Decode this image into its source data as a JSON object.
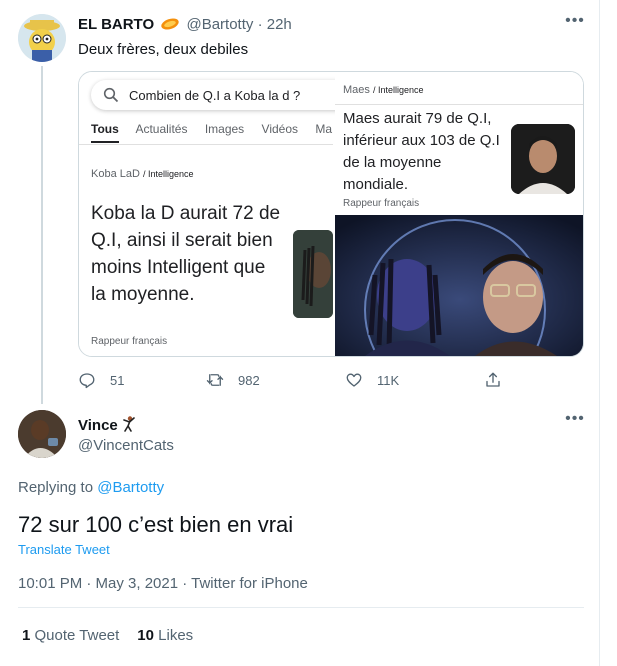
{
  "parent": {
    "display_name": "EL BARTO",
    "handle": "@Bartotty",
    "separator": "·",
    "time": "22h",
    "text": "Deux frères, deux debiles",
    "media": {
      "search_query": "Combien de Q.I a Koba la d ?",
      "tabs": [
        "Tous",
        "Actualités",
        "Images",
        "Vidéos",
        "Ma"
      ],
      "left_crumb": "Koba LaD",
      "left_crumb_sub": "/ Intelligence",
      "left_text": "Koba la D aurait 72 de Q.I, ainsi il serait bien moins Intelligent que la moyenne.",
      "left_source": "Rappeur français",
      "right_crumb": "Maes",
      "right_crumb_sub": "/ Intelligence",
      "right_text": "Maes aurait 79 de Q.I, inférieur aux 103 de Q.I de la moyenne mondiale.",
      "right_source": "Rappeur français"
    },
    "actions": {
      "replies": "51",
      "retweets": "982",
      "likes": "11K"
    }
  },
  "reply": {
    "display_name": "Vince",
    "handle": "@VincentCats",
    "replying_label": "Replying to",
    "replying_to": "@Bartotty",
    "text": "72 sur 100 c’est bien en vrai",
    "translate_label": "Translate Tweet",
    "meta": "10:01 PM · May 3, 2021 · Twitter for iPhone",
    "quote_count": "1",
    "quote_label": "Quote Tweet",
    "like_count": "10",
    "like_label": "Likes"
  },
  "colors": {
    "accent": "#1d9bf0",
    "muted": "#536471",
    "text": "#0f1419",
    "border": "#cfd9de",
    "emoji_orange": "#f4900c"
  },
  "icons": {
    "reply": "reply-icon",
    "retweet": "retweet-icon",
    "like": "heart-icon",
    "share": "share-icon",
    "more": "more-dots-icon"
  }
}
